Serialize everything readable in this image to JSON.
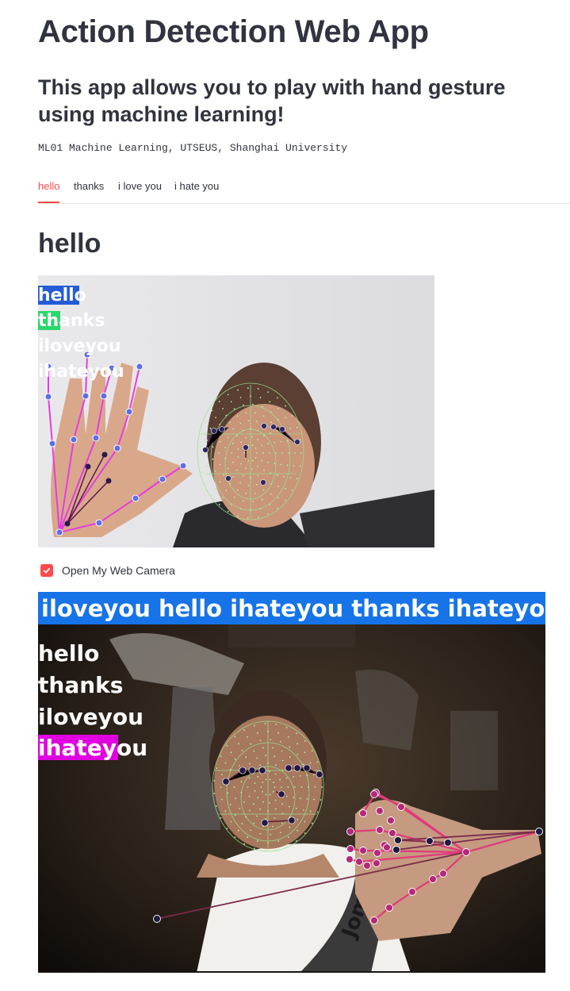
{
  "header": {
    "title": "Action Detection Web App",
    "subtitle": "This app allows you to play with hand gesture using machine learning!",
    "caption": "ML01 Machine Learning, UTSEUS, Shanghai University"
  },
  "tabs": [
    {
      "label": "hello",
      "active": true
    },
    {
      "label": "thanks",
      "active": false
    },
    {
      "label": "i love you",
      "active": false
    },
    {
      "label": "i hate you",
      "active": false
    }
  ],
  "section": {
    "title": "hello"
  },
  "example_image": {
    "labels": [
      "hello",
      "thanks",
      "iloveyou",
      "ihateyou"
    ],
    "bar_colors": [
      "#245bd6",
      "#2bd66b"
    ]
  },
  "camera": {
    "checkbox_label": "Open My Web Camera",
    "checked": true
  },
  "live_image": {
    "sentence": "iloveyou hello ihateyou thanks ihateyou",
    "labels": [
      "hello",
      "thanks",
      "iloveyou",
      "ihateyou"
    ],
    "highlight_color": "#e000e0",
    "sentence_bar_color": "#1673e8",
    "shirt_text": "Joma"
  },
  "colors": {
    "accent": "#ff4b4b",
    "text": "#31333f"
  }
}
